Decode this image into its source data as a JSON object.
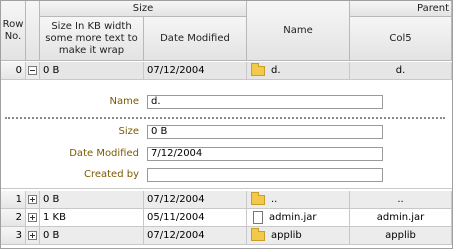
{
  "headers": {
    "row_no": "Row No.",
    "size_group": "Size",
    "size_kb": "Size In KB width some more text to make it wrap",
    "date_modified": "Date Modified",
    "name": "Name",
    "parent_group": "Parent",
    "col5": "Col5"
  },
  "expanded_row": {
    "row": "0",
    "size": "0 B",
    "date": "07/12/2004",
    "name": "d.",
    "col5": "d."
  },
  "detail": {
    "name_label": "Name",
    "name_value": "d.",
    "size_label": "Size",
    "size_value": "0 B",
    "date_label": "Date Modified",
    "date_value": "7/12/2004",
    "created_label": "Created by",
    "created_value": ""
  },
  "rows": [
    {
      "row": "1",
      "size": "0 B",
      "date": "07/12/2004",
      "name": "..",
      "col5": "..",
      "icon": "folder-icon"
    },
    {
      "row": "2",
      "size": "1 KB",
      "date": "05/11/2004",
      "name": "admin.jar",
      "col5": "admin.jar",
      "icon": "file-icon"
    },
    {
      "row": "3",
      "size": "0 B",
      "date": "07/12/2004",
      "name": "applib",
      "col5": "applib",
      "icon": "folder-icon"
    }
  ],
  "colors": {
    "label": "#7a5a00",
    "header": "#e8e8e8",
    "selected_row": "#e6e6e6"
  }
}
